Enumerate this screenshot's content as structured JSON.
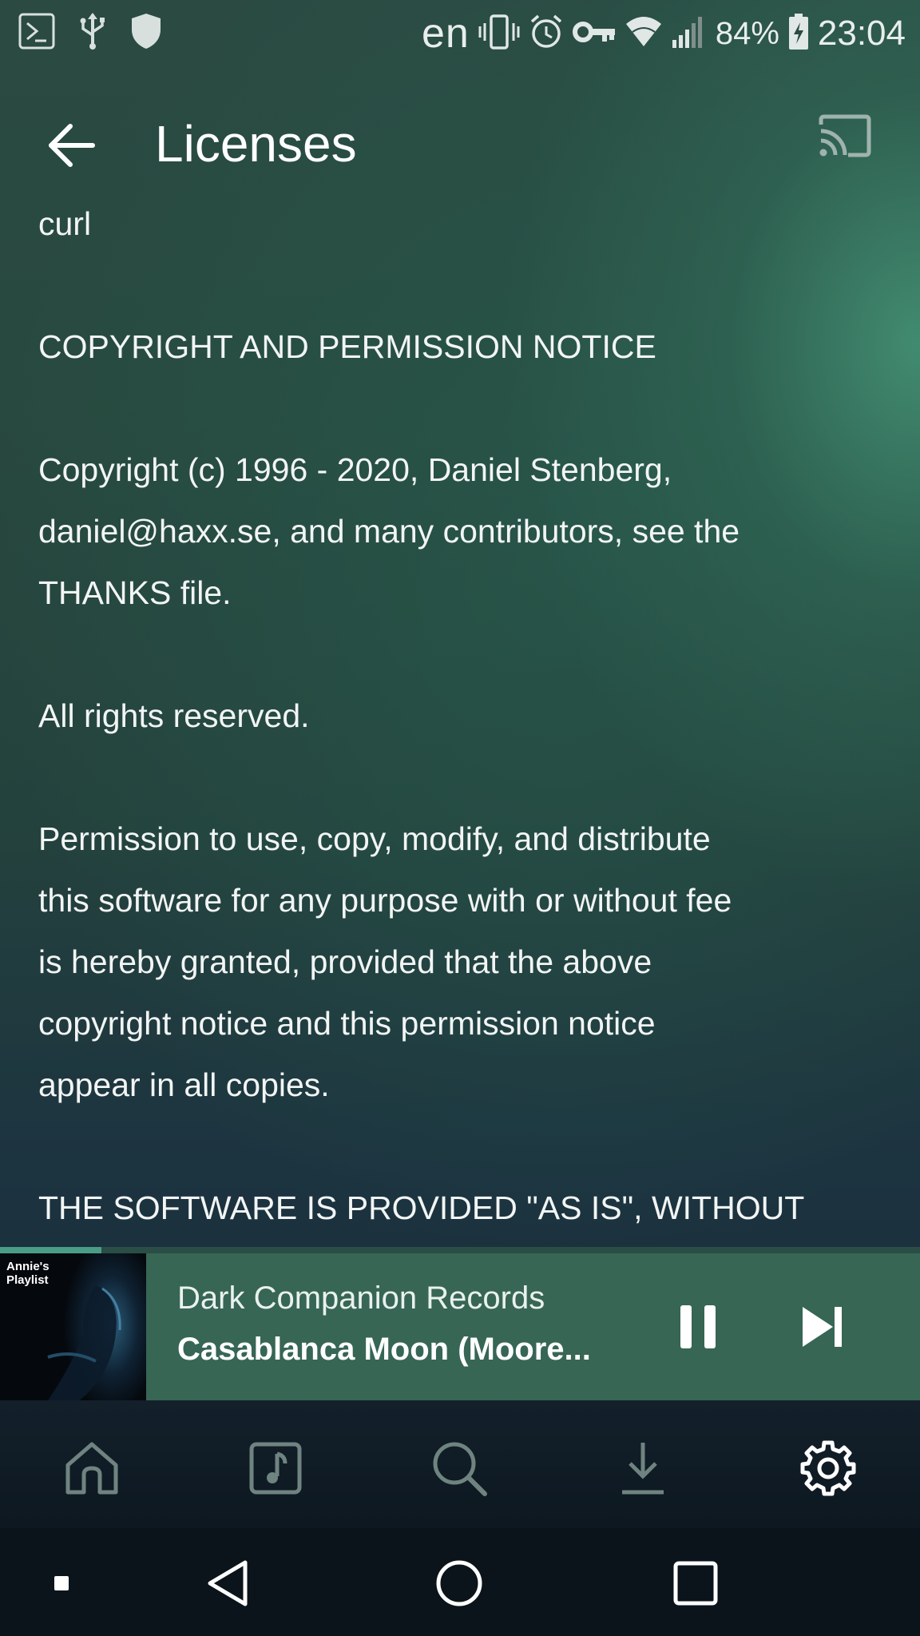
{
  "status_bar": {
    "left_icons": [
      "terminal-icon",
      "usb-icon",
      "shield-icon"
    ],
    "language": "en",
    "right_icons": [
      "vibrate-icon",
      "alarm-icon",
      "vpn-key-icon",
      "wifi-icon",
      "cell-signal-icon",
      "battery-charging-icon"
    ],
    "battery_percent": "84%",
    "time": "23:04"
  },
  "app_bar": {
    "title": "Licenses",
    "back_icon": "back-arrow-icon",
    "cast_icon": "cast-icon"
  },
  "license": {
    "paragraphs": [
      "curl",
      "",
      "COPYRIGHT AND PERMISSION NOTICE",
      "",
      "Copyright (c) 1996 - 2020, Daniel Stenberg,",
      "daniel@haxx.se, and many contributors, see the",
      "THANKS file.",
      "",
      "All rights reserved.",
      "",
      "Permission to use, copy, modify, and distribute",
      "this software for any purpose with or without fee",
      "is hereby granted, provided that the above",
      "copyright notice and this permission notice",
      "appear in all copies.",
      "",
      "THE SOFTWARE IS PROVIDED \"AS IS\", WITHOUT"
    ]
  },
  "now_playing": {
    "progress_fraction": 0.11,
    "album_caption": "Annie's Playlist",
    "artist": "Dark Companion Records",
    "track": "Casablanca Moon (Moore...",
    "pause_icon": "pause-icon",
    "next_icon": "skip-next-icon"
  },
  "bottom_nav": {
    "items": [
      {
        "name": "home",
        "icon": "home-icon",
        "active": false
      },
      {
        "name": "music",
        "icon": "music-note-icon",
        "active": false
      },
      {
        "name": "search",
        "icon": "search-icon",
        "active": false
      },
      {
        "name": "downloads",
        "icon": "download-icon",
        "active": false
      },
      {
        "name": "settings",
        "icon": "gear-icon",
        "active": true
      }
    ]
  },
  "colors": {
    "accent": "#4a9c86",
    "now_playing_bg": "#376654",
    "inactive_nav": "#6f8480",
    "active_nav": "#ffffff"
  }
}
